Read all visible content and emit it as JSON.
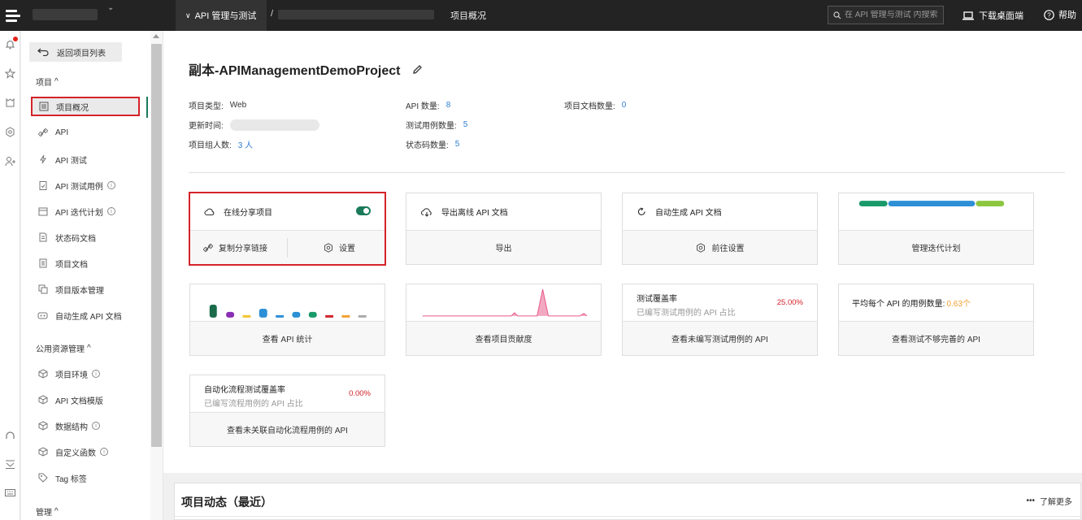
{
  "topbar": {
    "section_menu": "API 管理与测试",
    "separator": "/",
    "breadcrumb": "项目概况",
    "search_placeholder": "在 API 管理与测试 内搜索",
    "download_label": "下载桌面端",
    "help_label": "帮助"
  },
  "sidebar": {
    "back_label": "返回项目列表",
    "section_project": "项目",
    "section_public": "公用资源管理",
    "section_manage": "管理",
    "caret": "^",
    "project_items": [
      {
        "label": "项目概况",
        "icon": "overview-icon"
      },
      {
        "label": "API",
        "icon": "api-link-icon"
      },
      {
        "label": "API 测试",
        "icon": "lightning-icon"
      },
      {
        "label": "API 测试用例",
        "icon": "clipboard-check-icon"
      },
      {
        "label": "API 迭代计划",
        "icon": "calendar-icon"
      },
      {
        "label": "状态码文档",
        "icon": "document-icon"
      },
      {
        "label": "项目文档",
        "icon": "doc-icon"
      },
      {
        "label": "项目版本管理",
        "icon": "version-icon"
      },
      {
        "label": "自动生成 API 文档",
        "icon": "robot-icon"
      }
    ],
    "public_items": [
      {
        "label": "项目环境",
        "icon": "cube-icon"
      },
      {
        "label": "API 文档模版",
        "icon": "cube-icon"
      },
      {
        "label": "数据结构",
        "icon": "cube-icon"
      },
      {
        "label": "自定义函数",
        "icon": "cube-icon"
      },
      {
        "label": "Tag 标签",
        "icon": "tag-icon"
      }
    ],
    "info_glyph": "i"
  },
  "project": {
    "title": "副本-APIManagementDemoProject",
    "meta": {
      "type_label": "项目类型:",
      "type_value": "Web",
      "updated_label": "更新时间:",
      "members_label": "项目组人数:",
      "members_value": "3 人",
      "api_count_label": "API 数量:",
      "api_count_value": "8",
      "testcase_label": "测试用例数量:",
      "testcase_value": "5",
      "statuscode_label": "状态码数量:",
      "statuscode_value": "5",
      "doc_label": "项目文档数量:",
      "doc_value": "0"
    }
  },
  "cards": {
    "share": {
      "title": "在线分享项目",
      "copy_label": "复制分享链接",
      "settings_label": "设置",
      "toggle_on": true
    },
    "export": {
      "title": "导出离线 API 文档",
      "action": "导出"
    },
    "autogen": {
      "title": "自动生成 API 文档",
      "action": "前往设置"
    },
    "iteration": {
      "action": "管理迭代计划",
      "progress": [
        0.2,
        0.6,
        0.2
      ],
      "colors": [
        "#1a9a6a",
        "#2d8fd6",
        "#8cc63f"
      ]
    },
    "api_stats": {
      "action": "查看 API 统计",
      "bar_colors": [
        "#1a6b4a",
        "#8a2fb5",
        "#f4c430",
        "#2d8fd6",
        "#2d8fd6",
        "#2d8fd6",
        "#1a9a6a",
        "#d4232a",
        "#f4a030",
        "#aaaaaa"
      ]
    },
    "contrib": {
      "action": "查看项目贡献度",
      "line_color": "#e85a8a"
    },
    "coverage": {
      "title": "测试覆盖率",
      "subtitle": "已编写测试用例的 API 占比",
      "value": "25.00%",
      "action": "查看未编写测试用例的 API"
    },
    "avg_cases": {
      "title": "平均每个 API 的用例数量:",
      "value": "0.63个",
      "action": "查看测试不够完善的 API"
    },
    "auto_coverage": {
      "title": "自动化流程测试覆盖率",
      "subtitle": "已编写流程用例的 API 占比",
      "value": "0.00%",
      "action": "查看未关联自动化流程用例的 API"
    }
  },
  "activity": {
    "title": "项目动态（最近）",
    "more_label": "了解更多",
    "more_glyph": "•••"
  }
}
